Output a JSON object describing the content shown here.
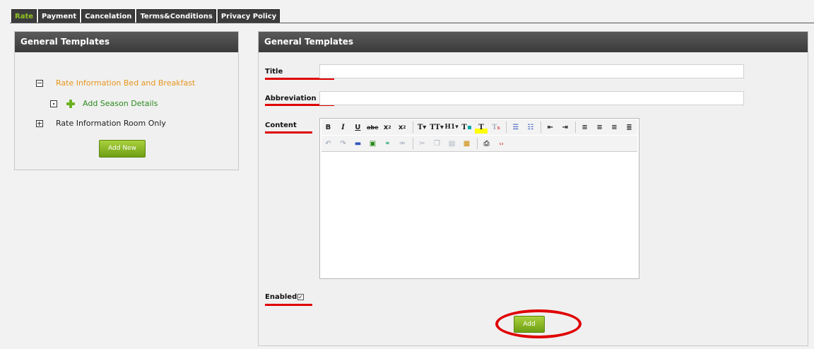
{
  "tabs": [
    {
      "label": "Rate",
      "active": true
    },
    {
      "label": "Payment",
      "active": false
    },
    {
      "label": "Cancelation",
      "active": false
    },
    {
      "label": "Terms&Conditions",
      "active": false
    },
    {
      "label": "Privacy Policy",
      "active": false
    }
  ],
  "left_panel": {
    "title": "General Templates",
    "tree": [
      {
        "label": "Rate Information Bed and Breakfast",
        "color": "#e8961e",
        "toggle": "minus"
      },
      {
        "label": "Add Season Details",
        "color": "#2a8a1e",
        "toggle": "dot",
        "icon": "green-plus-icon"
      },
      {
        "label": "Rate Information Room Only",
        "color": "#222222",
        "toggle": "plus"
      }
    ],
    "add_new_label": "Add New"
  },
  "right_panel": {
    "title": "General Templates",
    "title_label": "Title",
    "title_value": "",
    "abbreviation_label": "Abbreviation",
    "abbreviation_value": "",
    "content_label": "Content",
    "enabled_label": "Enabled",
    "enabled_checked": true,
    "add_label": "Add"
  },
  "toolbar": {
    "row1": [
      "bold-icon",
      "italic-icon",
      "underline-icon",
      "strikethrough-icon",
      "subscript-icon",
      "superscript-icon",
      "font-family-icon",
      "font-size-icon",
      "heading-icon",
      "text-color-icon",
      "highlight-icon",
      "remove-format-icon",
      "unordered-list-icon",
      "ordered-list-icon",
      "outdent-icon",
      "indent-icon",
      "align-left-icon",
      "align-center-icon",
      "align-right-icon",
      "justify-icon"
    ],
    "row2": [
      "undo-icon",
      "redo-icon",
      "horizontal-rule-icon",
      "image-icon",
      "link-icon",
      "unlink-icon",
      "cut-icon",
      "copy-icon",
      "paste-icon",
      "paste-word-icon",
      "print-icon",
      "source-icon"
    ]
  },
  "colors": {
    "accent": "#8fc322",
    "annotation": "#e00000",
    "header": "#444444"
  }
}
